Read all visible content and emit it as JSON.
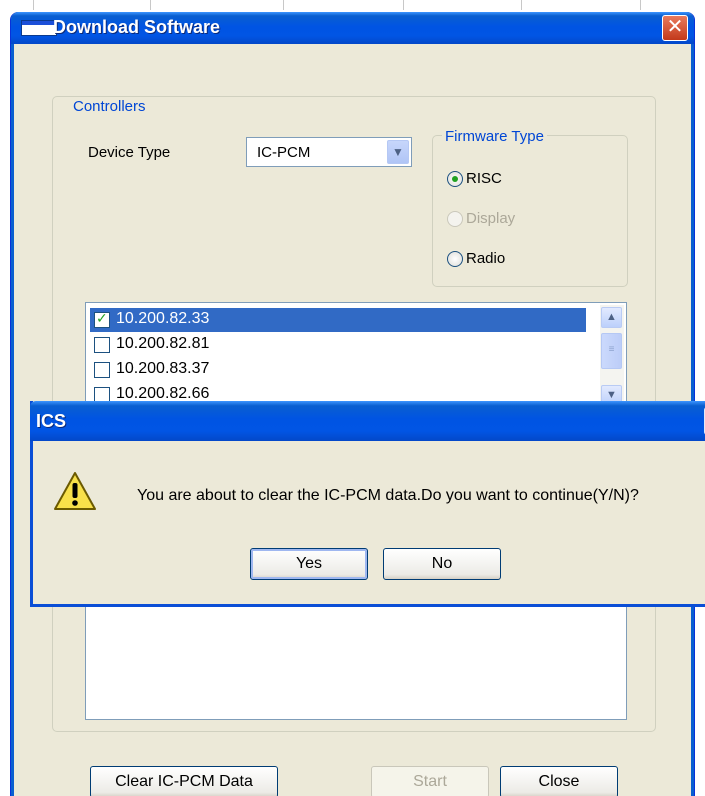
{
  "window": {
    "title": "Download Software",
    "close_label": "✕"
  },
  "controllers": {
    "legend": "Controllers",
    "device_type_label": "Device Type",
    "device_type_value": "IC-PCM",
    "dropdown_arrow": "▼"
  },
  "firmware": {
    "legend": "Firmware Type",
    "options": [
      {
        "label": "RISC",
        "selected": true,
        "enabled": true
      },
      {
        "label": "Display",
        "selected": false,
        "enabled": false
      },
      {
        "label": "Radio",
        "selected": false,
        "enabled": true
      }
    ]
  },
  "device_list": {
    "items": [
      {
        "ip": "10.200.82.33",
        "checked": true,
        "selected": true
      },
      {
        "ip": "10.200.82.81",
        "checked": false,
        "selected": false
      },
      {
        "ip": "10.200.83.37",
        "checked": false,
        "selected": false
      },
      {
        "ip": "10.200.82.66",
        "checked": false,
        "selected": false
      }
    ],
    "scroll_up": "▲",
    "scroll_down": "▼",
    "thumb_grip": "≡"
  },
  "buttons": {
    "clear": "Clear IC-PCM Data",
    "start": "Start",
    "close": "Close"
  },
  "dialog": {
    "title": "ICS",
    "close_label": "✕",
    "message": "You are about to clear the IC-PCM data.Do you want to continue(Y/N)?",
    "yes": "Yes",
    "no": "No",
    "icon": "warning-icon"
  },
  "colors": {
    "titlebar": "#0054e3",
    "selection": "#316ac5",
    "group_legend": "#0046d5",
    "face": "#ece9d8"
  }
}
